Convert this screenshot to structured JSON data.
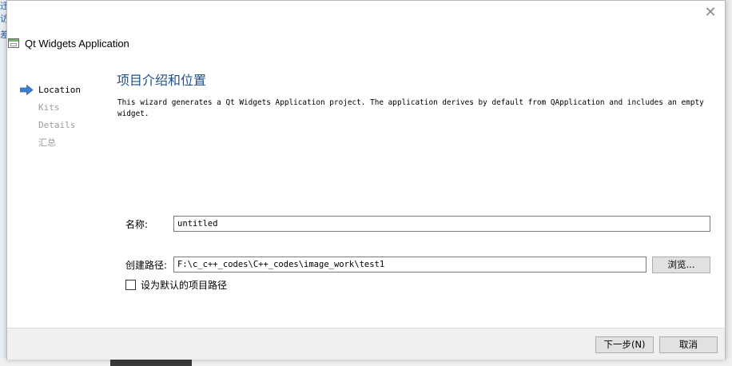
{
  "background": {
    "left_fragments": [
      "迁",
      "访",
      "差"
    ]
  },
  "window": {
    "title": "Qt Widgets Application",
    "close_symbol": "✕"
  },
  "sidebar": {
    "steps": [
      {
        "label": "Location",
        "active": true
      },
      {
        "label": "Kits",
        "active": false
      },
      {
        "label": "Details",
        "active": false
      },
      {
        "label": "汇总",
        "active": false
      }
    ]
  },
  "main": {
    "heading": "项目介绍和位置",
    "description": "This wizard generates a Qt Widgets Application project. The application derives by default from QApplication and includes an empty widget.",
    "name_label": "名称:",
    "name_value": "untitled",
    "path_label": "创建路径:",
    "path_value": "F:\\c_c++_codes\\C++_codes\\image_work\\test1",
    "browse_label": "浏览...",
    "default_path_label": "设为默认的项目路径",
    "default_path_checked": false
  },
  "footer": {
    "next_label": "下一步(N)",
    "cancel_label": "取消"
  },
  "colors": {
    "heading": "#1f4e8c",
    "active_arrow": "#3d7fd1"
  }
}
